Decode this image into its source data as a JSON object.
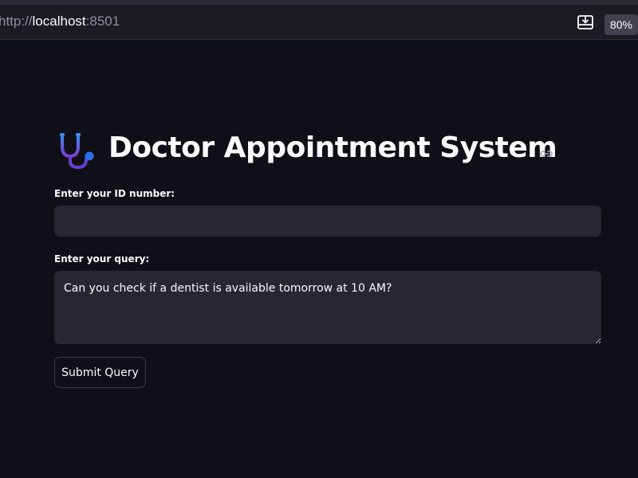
{
  "browser": {
    "url_scheme": "http://",
    "url_host": "localhost",
    "url_port": ":8501",
    "zoom": "80%",
    "download_icon": "download-icon"
  },
  "app": {
    "title": "Doctor Appointment System",
    "title_icon": "stethoscope-icon",
    "anchor_icon": "link-icon",
    "id_field": {
      "label": "Enter your ID number:",
      "value": ""
    },
    "query_field": {
      "label": "Enter your query:",
      "value": "Can you check if a dentist is available tomorrow at 10 AM?"
    },
    "submit_label": "Submit Query"
  },
  "colors": {
    "background": "#0f1017",
    "input_bg": "#262730",
    "stetho_top": "#3b8ef0",
    "stetho_bottom": "#6a3fd1",
    "stetho_knob": "#2d6fe8"
  }
}
